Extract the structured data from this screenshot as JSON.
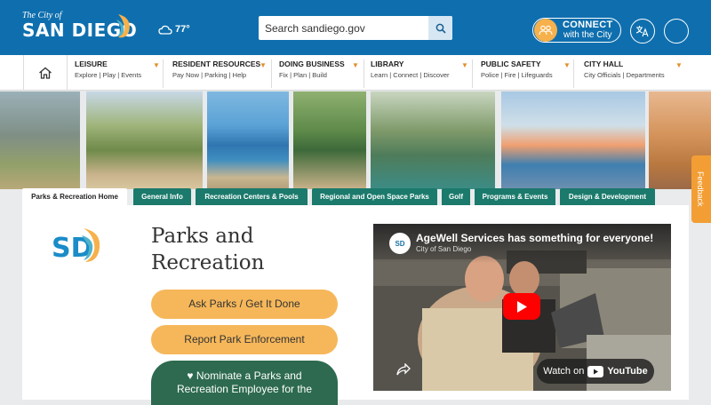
{
  "header": {
    "logo_small": "The City of",
    "logo_big": "SAN DIEGO",
    "weather": "77°",
    "search_placeholder": "Search sandiego.gov",
    "connect_title": "CONNECT",
    "connect_sub": "with the City"
  },
  "nav": {
    "items": [
      {
        "title": "LEISURE",
        "sub": "Explore | Play | Events"
      },
      {
        "title": "RESIDENT RESOURCES",
        "sub": "Pay Now | Parking | Help"
      },
      {
        "title": "DOING BUSINESS",
        "sub": "Fix | Plan | Build"
      },
      {
        "title": "LIBRARY",
        "sub": "Learn | Connect | Discover"
      },
      {
        "title": "PUBLIC SAFETY",
        "sub": "Police | Fire | Lifeguards"
      },
      {
        "title": "CITY HALL",
        "sub": "City Officials | Departments"
      }
    ]
  },
  "tabs": [
    "Parks & Recreation Home",
    "General Info",
    "Recreation Centers & Pools",
    "Regional and Open Space Parks",
    "Golf",
    "Programs & Events",
    "Design & Development"
  ],
  "main": {
    "title_line1": "Parks and",
    "title_line2": "Recreation",
    "logo_text": "SD",
    "buttons": [
      "Ask Parks / Get It Done",
      "Report Park Enforcement"
    ],
    "nominate_line1": "♥ Nominate a Parks and",
    "nominate_line2": "Recreation Employee for the"
  },
  "video": {
    "title": "AgeWell Services has something for everyone!",
    "channel": "City of San Diego",
    "avatar_text": "SD",
    "watch_on": "Watch on",
    "youtube": "YouTube"
  },
  "feedback": "Feedback",
  "colors": {
    "header_blue": "#0f6fae",
    "tab_green": "#1b7a6c",
    "button_yellow": "#f6b75a",
    "button_green": "#2d6a4f",
    "accent_orange": "#f29e34"
  }
}
